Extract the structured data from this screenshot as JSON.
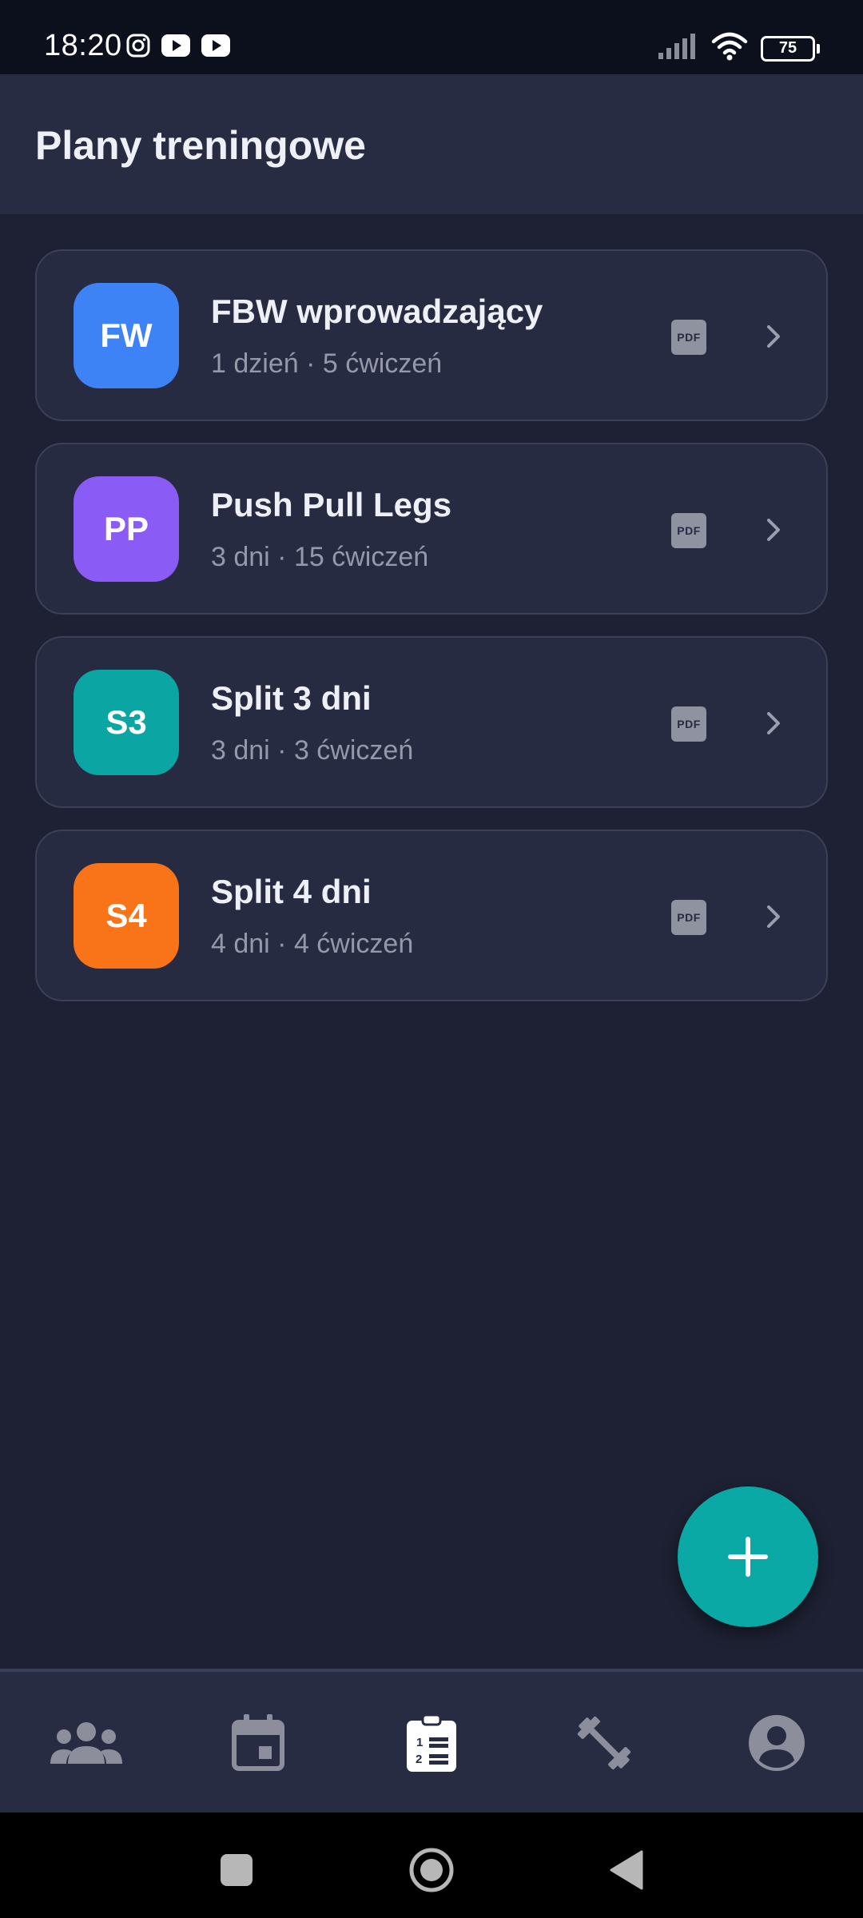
{
  "status_bar": {
    "time": "18:20",
    "battery": "75",
    "app_icons": [
      "instagram-icon",
      "youtube-icon",
      "youtube-icon"
    ],
    "system_icons": [
      "signal-icon",
      "wifi-icon",
      "battery-icon"
    ]
  },
  "header": {
    "title": "Plany treningowe"
  },
  "plans": [
    {
      "initials": "FW",
      "name": "FBW wprowadzający",
      "meta": "1 dzień · 5 ćwiczeń",
      "color": "#3d83f6",
      "pdf_label": "PDF"
    },
    {
      "initials": "PP",
      "name": "Push Pull Legs",
      "meta": "3 dni · 15 ćwiczeń",
      "color": "#8a5cf5",
      "pdf_label": "PDF"
    },
    {
      "initials": "S3",
      "name": "Split 3 dni",
      "meta": "3 dni · 3 ćwiczeń",
      "color": "#0ba5a3",
      "pdf_label": "PDF"
    },
    {
      "initials": "S4",
      "name": "Split 4 dni",
      "meta": "4 dni · 4 ćwiczeń",
      "color": "#f97318",
      "pdf_label": "PDF"
    }
  ],
  "fab": {
    "icon": "plus-icon",
    "color": "#0aa9a6"
  },
  "bottom_nav": {
    "items": [
      {
        "icon": "group-icon",
        "active": false
      },
      {
        "icon": "calendar-icon",
        "active": false
      },
      {
        "icon": "clipboard-list-icon",
        "active": true
      },
      {
        "icon": "dumbbell-icon",
        "active": false
      },
      {
        "icon": "account-circle-icon",
        "active": false
      }
    ]
  },
  "system_nav": {
    "icons": [
      "recents-icon",
      "home-icon",
      "back-icon"
    ]
  },
  "colors": {
    "background": "#1e2133",
    "header": "#272c42",
    "card": "#272b41",
    "text_primary": "#eef0f6",
    "text_secondary": "#9498a8",
    "accent": "#0aa9a6"
  }
}
